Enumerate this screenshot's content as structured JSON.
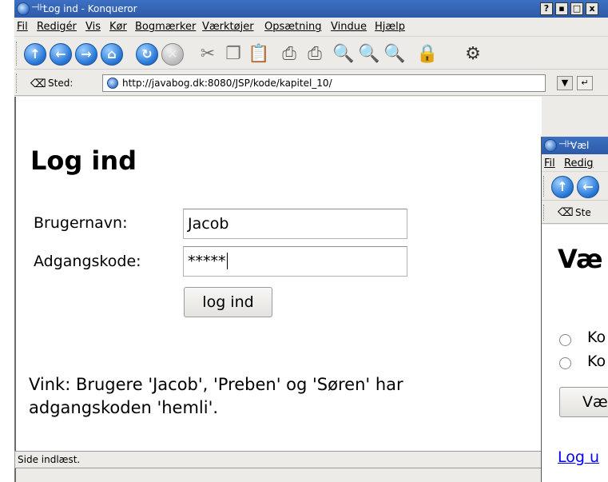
{
  "window": {
    "title": "Log ind - Konqueror",
    "controls": [
      "?",
      "▪",
      "□",
      "x"
    ]
  },
  "menubar": {
    "items": [
      "Fil",
      "Redigér",
      "Vis",
      "Kør",
      "Bogmærker",
      "Værktøjer",
      "Opsætning",
      "Vindue",
      "Hjælp"
    ]
  },
  "toolbar": {
    "icons": [
      "up-icon",
      "back-icon",
      "forward-icon",
      "home-icon",
      "reload-icon",
      "stop-icon",
      "cut-icon",
      "copy-icon",
      "paste-icon",
      "print-icon",
      "print-frame-icon",
      "zoom-in-icon",
      "zoom-in-alt-icon",
      "zoom-out-icon",
      "lock-icon",
      "gear-icon"
    ]
  },
  "location": {
    "label": "Sted:",
    "url": "http://javabog.dk:8080/JSP/kode/kapitel_10/"
  },
  "page": {
    "heading": "Log ind",
    "username_label": "Brugernavn:",
    "username_value": "Jacob",
    "password_label": "Adgangskode:",
    "password_value": "*****",
    "submit_label": "log ind",
    "hint": "Vink: Brugere 'Jacob', 'Preben' og 'Søren' har adgangskoden 'hemli'."
  },
  "status": {
    "text": "Side indlæst."
  },
  "window2": {
    "title": "Væl",
    "menu_items": [
      "Fil",
      "Redig"
    ],
    "location_label": "Ste",
    "heading": "Væ",
    "options": [
      "Ko",
      "Ko"
    ],
    "button_label": "Væ",
    "link": "Log u"
  }
}
